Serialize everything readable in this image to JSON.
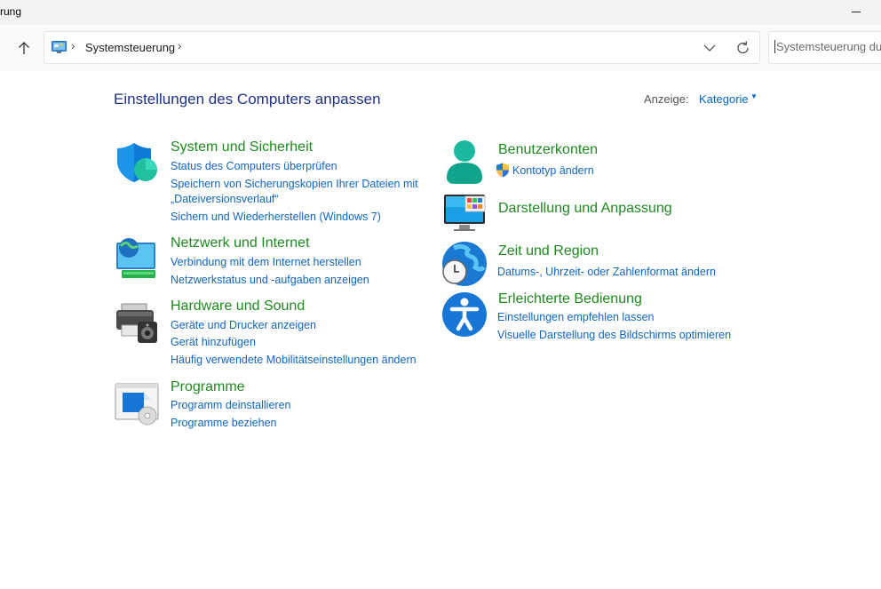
{
  "window": {
    "title": "rung"
  },
  "address": {
    "crumb": "Systemsteuerung",
    "separator": "›"
  },
  "search": {
    "placeholder": "Systemsteuerung durchsuchen"
  },
  "main": {
    "heading": "Einstellungen des Computers anpassen",
    "view_label": "Anzeige:",
    "view_value": "Kategorie"
  },
  "categories": {
    "system": {
      "title": "System und Sicherheit",
      "links": [
        "Status des Computers überprüfen",
        "Speichern von Sicherungskopien Ihrer Dateien mit",
        "„Dateiversionsverlauf“",
        "Sichern und Wiederherstellen (Windows 7)"
      ]
    },
    "network": {
      "title": "Netzwerk und Internet",
      "links": [
        "Verbindung mit dem Internet herstellen",
        "Netzwerkstatus und -aufgaben anzeigen"
      ]
    },
    "hardware": {
      "title": "Hardware und Sound",
      "links": [
        "Geräte und Drucker anzeigen",
        "Gerät hinzufügen",
        "Häufig verwendete Mobilitätseinstellungen ändern"
      ]
    },
    "programs": {
      "title": "Programme",
      "links": [
        "Programm deinstallieren",
        "Programme beziehen"
      ]
    },
    "accounts": {
      "title": "Benutzerkonten",
      "links": [
        "Kontotyp ändern"
      ]
    },
    "appearance": {
      "title": "Darstellung und Anpassung",
      "links": []
    },
    "clock": {
      "title": "Zeit und Region",
      "links": [
        "Datums-, Uhrzeit- oder Zahlenformat ändern"
      ]
    },
    "ease": {
      "title": "Erleichterte Bedienung",
      "links": [
        "Einstellungen empfehlen lassen",
        "Visuelle Darstellung des Bildschirms optimieren"
      ]
    }
  },
  "colors": {
    "heading": "#1e3287",
    "category_title": "#1e8a1e",
    "link": "#0f66c4"
  },
  "icons": {
    "system": "shield-icon",
    "network": "network-icon",
    "hardware": "printer-icon",
    "programs": "programs-icon",
    "accounts": "user-icon",
    "appearance": "monitor-icon",
    "clock": "clock-globe-icon",
    "ease": "accessibility-icon"
  }
}
